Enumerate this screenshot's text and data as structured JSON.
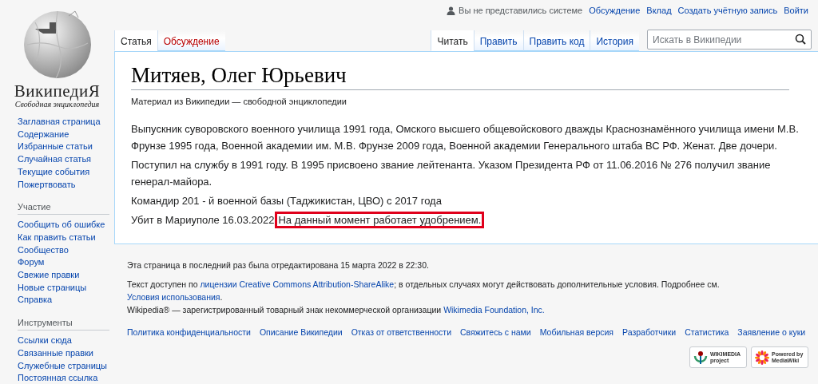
{
  "personal": {
    "user_status": "Вы не представились системе",
    "links": [
      "Обсуждение",
      "Вклад",
      "Создать учётную запись",
      "Войти"
    ]
  },
  "logo": {
    "title": "ВикипедиЯ",
    "subtitle": "Свободная энциклопедия"
  },
  "tabs_left": [
    {
      "label": "Статья",
      "selected": true
    },
    {
      "label": "Обсуждение",
      "selected": false
    }
  ],
  "tabs_right": [
    {
      "label": "Читать",
      "selected": true
    },
    {
      "label": "Править",
      "selected": false
    },
    {
      "label": "Править код",
      "selected": false
    },
    {
      "label": "История",
      "selected": false
    }
  ],
  "search": {
    "placeholder": "Искать в Википедии"
  },
  "sidebar": [
    {
      "items": [
        "Заглавная страница",
        "Содержание",
        "Избранные статьи",
        "Случайная статья",
        "Текущие события",
        "Пожертвовать"
      ]
    },
    {
      "heading": "Участие",
      "items": [
        "Сообщить об ошибке",
        "Как править статьи",
        "Сообщество",
        "Форум",
        "Свежие правки",
        "Новые страницы",
        "Справка"
      ]
    },
    {
      "heading": "Инструменты",
      "items": [
        "Ссылки сюда",
        "Связанные правки",
        "Служебные страницы",
        "Постоянная ссылка"
      ]
    }
  ],
  "article": {
    "title": "Митяев, Олег Юрьевич",
    "tagline": "Материал из Википедии — свободной энциклопедии",
    "paragraphs": [
      {
        "text": "Выпускник суворовского военного училища 1991 года, Омского высшего общевойскового дважды Краснознамённого училища имени М.В. Фрунзе 1995 года, Военной академии им. М.В. Фрунзе 2009 года, Военной академии Генерального штаба ВС РФ. Женат. Две дочери."
      },
      {
        "text": "Поступил на службу в 1991 году. В 1995 присвоено звание лейтенанта. Указом Президента РФ от 11.06.2016 № 276 получил звание генерал-майора."
      },
      {
        "text": "Командир 201 - й военной базы (Таджикистан, ЦВО) с 2017 года"
      },
      {
        "text": "Убит в Мариуполе 16.03.2022",
        "highlight": "На данный момент работает удобрением."
      }
    ]
  },
  "footer": {
    "last_edit": "Эта страница в последний раз была отредактирована 15 марта 2022 в 22:30.",
    "license": [
      {
        "text": "Текст доступен по ",
        "link": false
      },
      {
        "text": "лицензии Creative Commons Attribution-ShareAlike",
        "link": true
      },
      {
        "text": "; в отдельных случаях могут действовать дополнительные условия. Подробнее см. ",
        "link": false
      },
      {
        "text": "Условия использования",
        "link": true
      },
      {
        "text": ".",
        "link": false
      }
    ],
    "trademark": [
      {
        "text": "Wikipedia® — зарегистрированный товарный знак некоммерческой организации ",
        "link": false
      },
      {
        "text": "Wikimedia Foundation, Inc.",
        "link": true
      }
    ],
    "links": [
      "Политика конфиденциальности",
      "Описание Википедии",
      "Отказ от ответственности",
      "Свяжитесь с нами",
      "Мобильная версия",
      "Разработчики",
      "Статистика",
      "Заявление о куки"
    ],
    "badges": [
      {
        "kind": "wikimedia",
        "lines": [
          "WIKIMEDIA",
          "project"
        ]
      },
      {
        "kind": "mediawiki",
        "lines": [
          "Powered by",
          "MediaWiki"
        ]
      }
    ]
  }
}
